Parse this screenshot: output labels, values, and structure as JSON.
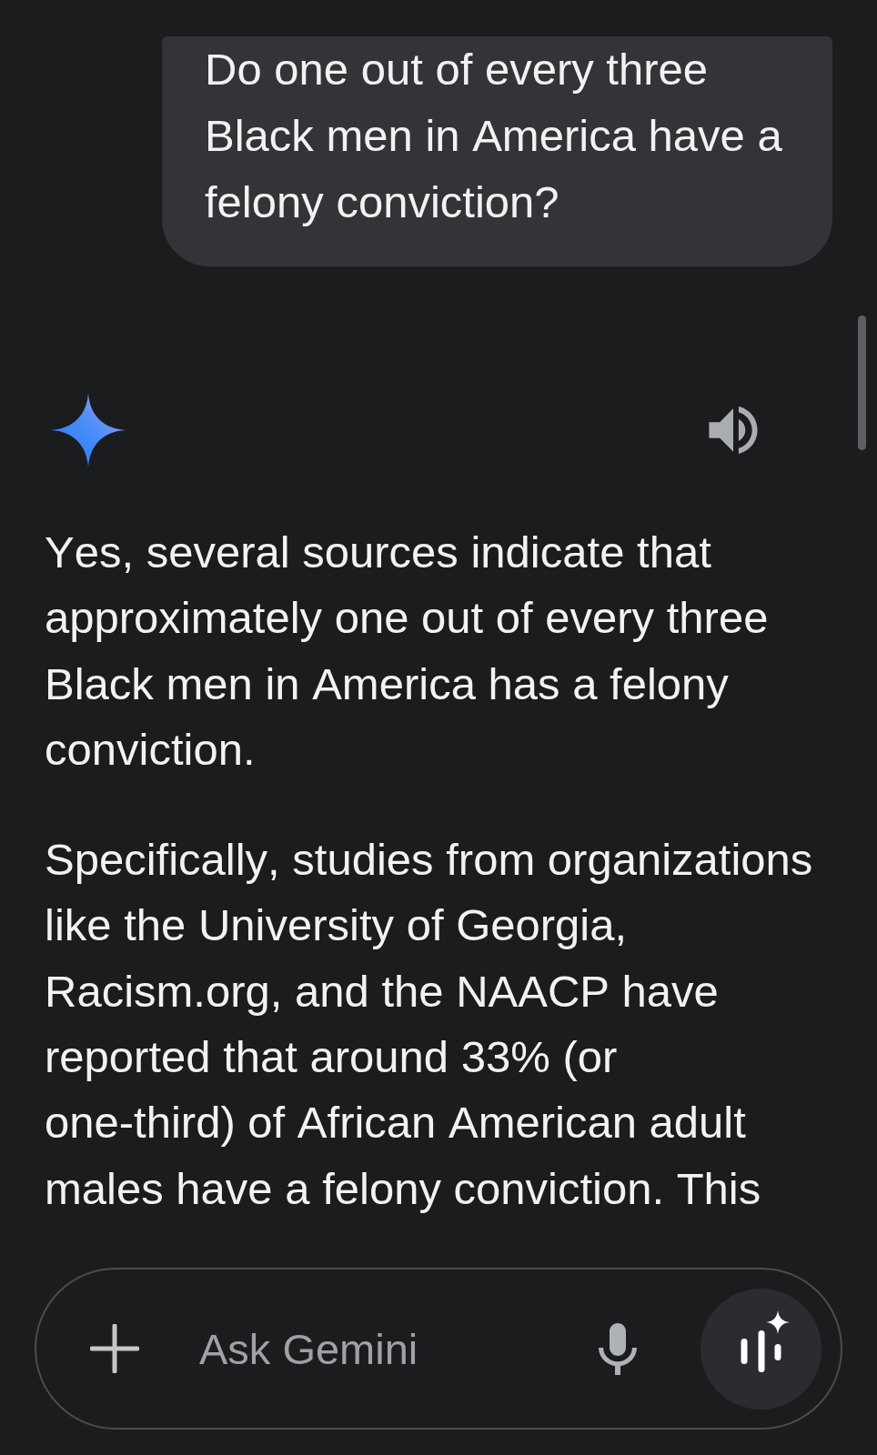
{
  "conversation": {
    "user_message": {
      "text": "Do one out of every three Black men in America have a felony conviction?"
    },
    "response": {
      "paragraphs": [
        "Yes, several sources indicate that approximately one out of every three Black men in America has a felony conviction.",
        "Specifically, studies from organizations like the University of Georgia, Racism.org, and the NAACP have reported that around 33% (or one-third) of African American adult males have a felony conviction. This"
      ]
    }
  },
  "composer": {
    "placeholder": "Ask Gemini"
  }
}
